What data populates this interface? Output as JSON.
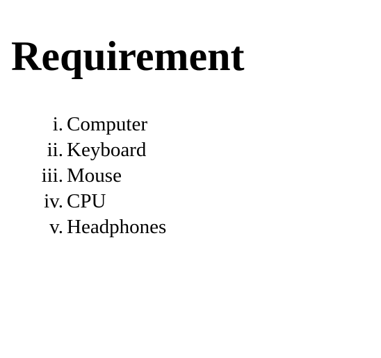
{
  "document": {
    "title": "Requirement",
    "items": [
      {
        "marker": "i.",
        "label": "Computer"
      },
      {
        "marker": "ii.",
        "label": "Keyboard"
      },
      {
        "marker": "iii.",
        "label": "Mouse"
      },
      {
        "marker": "iv.",
        "label": "CPU"
      },
      {
        "marker": "v.",
        "label": "Headphones"
      }
    ]
  }
}
